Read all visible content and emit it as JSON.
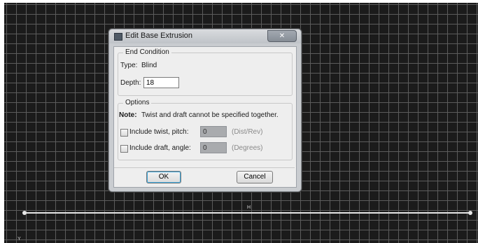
{
  "canvas": {
    "dimension_label": "H",
    "axis_label": "Y"
  },
  "dialog": {
    "title": "Edit Base Extrusion",
    "close_glyph": "✕",
    "end_condition": {
      "group_title": "End Condition",
      "type_label": "Type:",
      "type_value": "Blind",
      "depth_label": "Depth:",
      "depth_value": "18"
    },
    "options": {
      "group_title": "Options",
      "note_label": "Note:",
      "note_text": "Twist and draft cannot be specified together.",
      "twist": {
        "checked": false,
        "label": "Include twist, pitch:",
        "value": "0",
        "unit": "(Dist/Rev)"
      },
      "draft": {
        "checked": false,
        "label": "Include draft, angle:",
        "value": "0",
        "unit": "(Degrees)"
      }
    },
    "ok_label": "OK",
    "cancel_label": "Cancel"
  }
}
